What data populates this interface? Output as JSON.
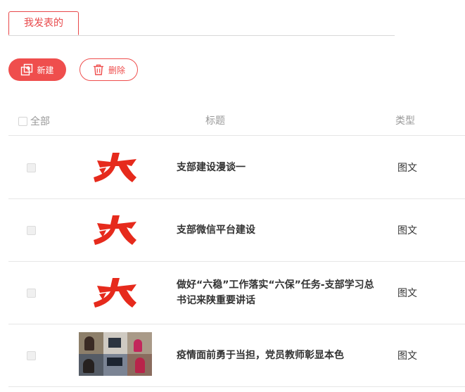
{
  "tabs": {
    "active_label": "我发表的"
  },
  "toolbar": {
    "new_label": "新建",
    "delete_label": "删除"
  },
  "table": {
    "headers": {
      "select_all": "全部",
      "title": "标题",
      "type": "类型"
    },
    "rows": [
      {
        "title": "支部建设漫谈一",
        "type": "图文",
        "thumb": "logo"
      },
      {
        "title": "支部微信平台建设",
        "type": "图文",
        "thumb": "logo"
      },
      {
        "title": "做好“六稳”工作落实“六保”任务-支部学习总书记来陕重要讲话",
        "type": "图文",
        "thumb": "logo"
      },
      {
        "title": "疫情面前勇于当担，党员教师彰显本色",
        "type": "图文",
        "thumb": "photo"
      }
    ]
  },
  "colors": {
    "accent": "#ef4e4d",
    "logo_red": "#e62a1c"
  }
}
